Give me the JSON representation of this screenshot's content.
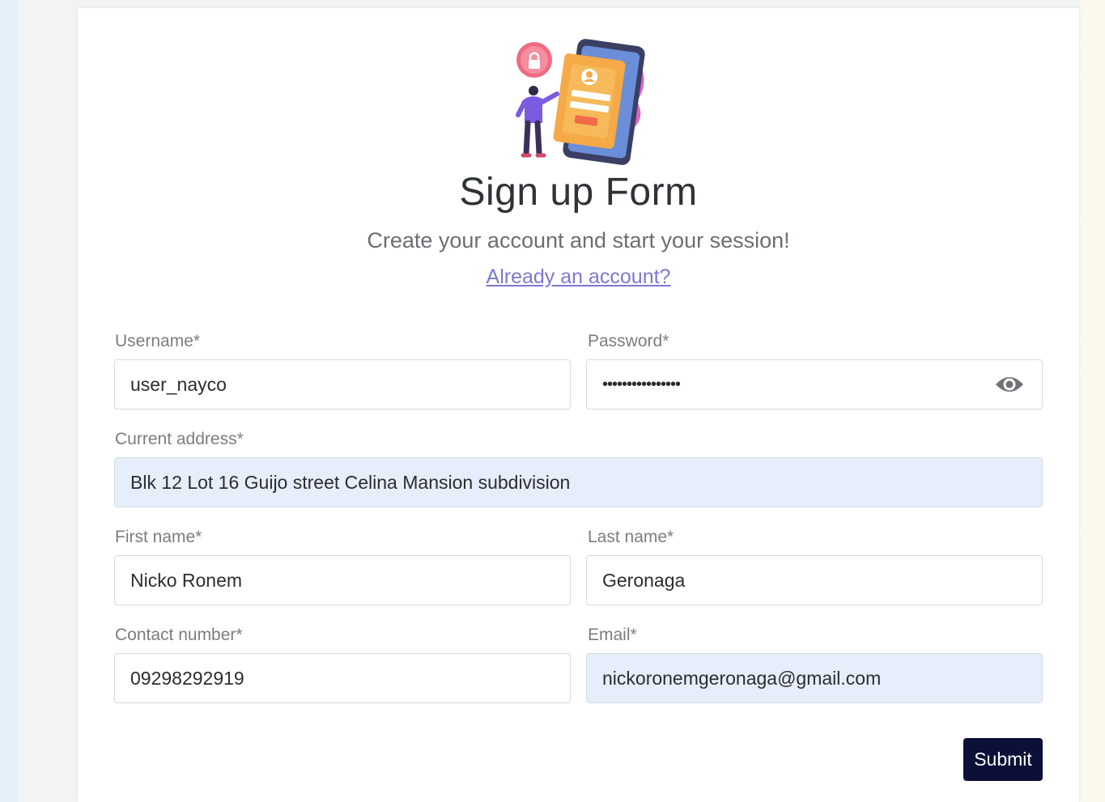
{
  "form": {
    "title": "Sign up Form",
    "subtitle": "Create your account and start your session!",
    "login_link": "Already an account?",
    "fields": {
      "username": {
        "label": "Username*",
        "value": "user_nayco"
      },
      "password": {
        "label": "Password*",
        "value": "••••••••••••••••"
      },
      "address": {
        "label": "Current address*",
        "value": "Blk 12 Lot 16 Guijo street Celina Mansion subdivision"
      },
      "first_name": {
        "label": "First name*",
        "value": "Nicko Ronem"
      },
      "last_name": {
        "label": "Last name*",
        "value": "Geronaga"
      },
      "contact": {
        "label": "Contact number*",
        "value": "09298292919"
      },
      "email": {
        "label": "Email*",
        "value": "nickoronemgeronaga@gmail.com"
      }
    },
    "submit_label": "Submit"
  },
  "icons": {
    "illustration": "signup-illustration",
    "password_toggle": "eye-icon"
  },
  "colors": {
    "primary_button": "#0c0f37",
    "link": "#7b79cf",
    "autofill_background": "#e7eefb"
  }
}
